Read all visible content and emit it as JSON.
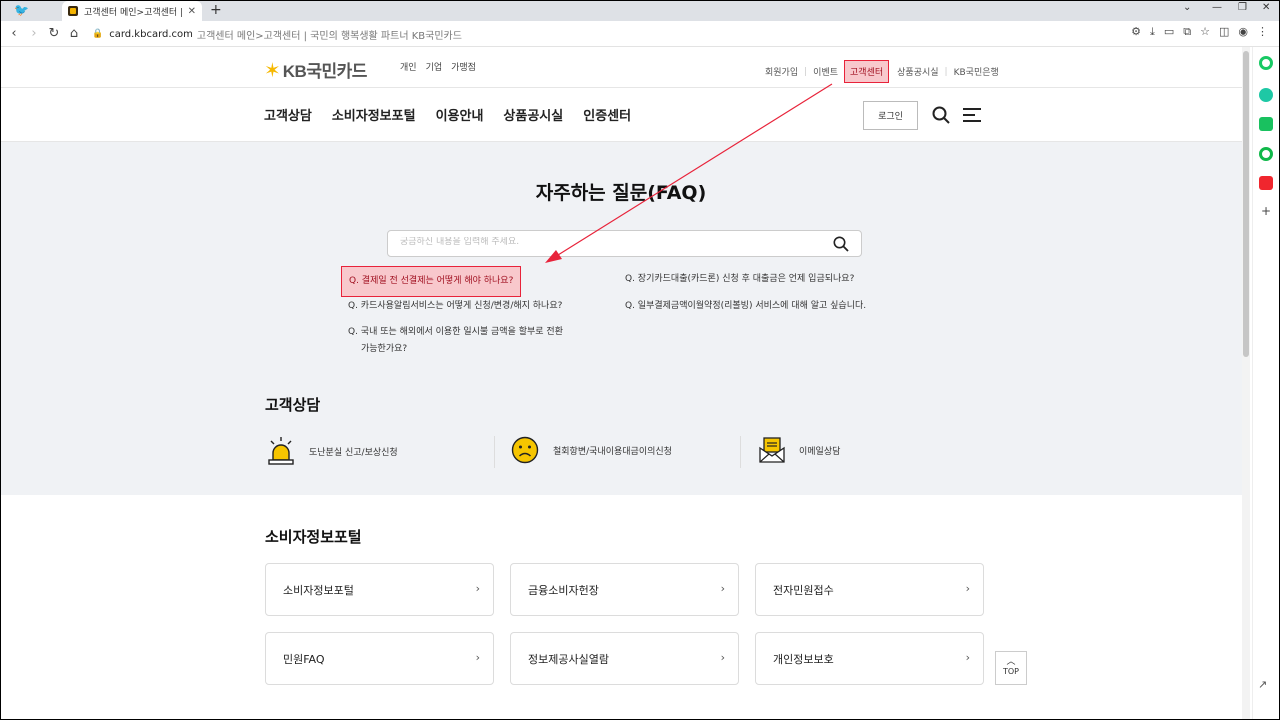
{
  "browser": {
    "tab_title": "고객센터 메인>고객센터 | 국민",
    "tab_close": "✕",
    "new_tab": "+",
    "url_domain": "card.kbcard.com",
    "url_title": "고객센터 메인>고객센터 | 국민의 행복생활 파트너 KB국민카드"
  },
  "header": {
    "logo_text": "KB국민카드",
    "segments": [
      "개인",
      "기업",
      "가맹점"
    ],
    "util_links": [
      "회원가입",
      "이벤트",
      "고객센터",
      "상품공시실",
      "KB국민은행"
    ],
    "util_separator": "|"
  },
  "gnb": {
    "menu": [
      "고객상담",
      "소비자정보포털",
      "이용안내",
      "상품공시실",
      "인증센터"
    ],
    "login": "로그인"
  },
  "faq": {
    "title": "자주하는 질문(FAQ)",
    "search_placeholder": "궁금하신 내용을 입력해 주세요.",
    "left": [
      "Q. 결제일 전 선결제는 어떻게 해야 하나요?",
      "Q. 카드사용알림서비스는 어떻게 신청/변경/해지 하나요?",
      "Q. 국내 또는 해외에서 이용한 일시불 금액을 할부로 전환",
      "가능한가요?"
    ],
    "right": [
      "Q. 장기카드대출(카드론) 신청 후 대출금은 언제 입금되나요?",
      "Q. 일부결제금액이월약정(리볼빙) 서비스에 대해 알고 싶습니다."
    ]
  },
  "consult": {
    "title": "고객상담",
    "items": [
      "도난분실 신고/보상신청",
      "철회항변/국내이용대금이의신청",
      "이메일상담"
    ]
  },
  "portal": {
    "title": "소비자정보포털",
    "cards": [
      "소비자정보포털",
      "금융소비자헌장",
      "전자민원접수",
      "민원FAQ",
      "정보제공사실열람",
      "개인정보보호"
    ],
    "chevron": "›"
  },
  "top_button": "TOP",
  "colors": {
    "brand_yellow": "#f6b800",
    "highlight_border": "#e8233a",
    "highlight_fill": "#f8c8cc",
    "band_gray": "#f0f2f5",
    "annotation_arrow": "#e8233a"
  }
}
